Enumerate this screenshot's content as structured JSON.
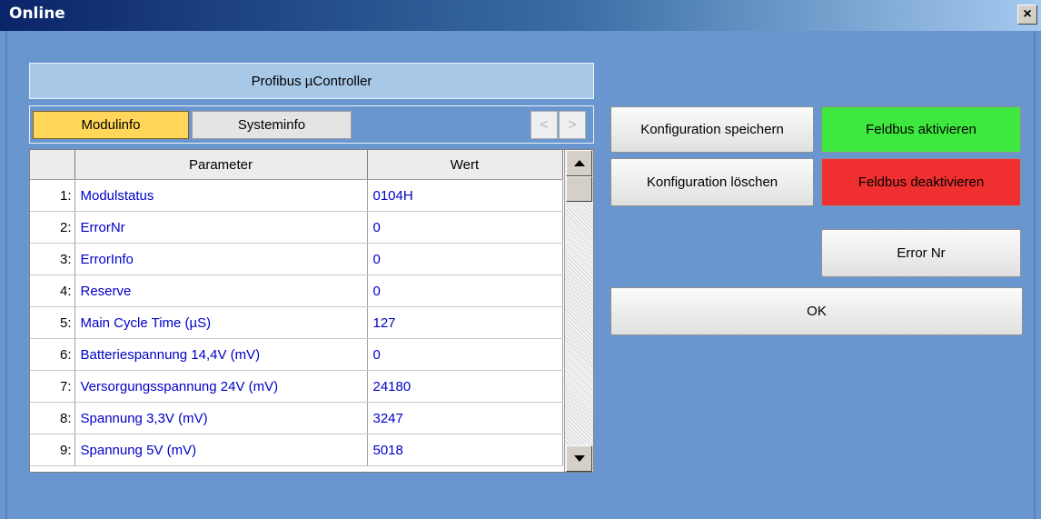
{
  "window": {
    "title": "Online",
    "close_glyph": "×"
  },
  "panel": {
    "header": "Profibus µController"
  },
  "tabs": {
    "modulinfo": "Modulinfo",
    "systeminfo": "Systeminfo",
    "prev": "<",
    "next": ">"
  },
  "table": {
    "columns": {
      "parameter": "Parameter",
      "wert": "Wert"
    },
    "rows": [
      {
        "num": "1:",
        "parameter": "Modulstatus",
        "wert": "0104H"
      },
      {
        "num": "2:",
        "parameter": "ErrorNr",
        "wert": "0"
      },
      {
        "num": "3:",
        "parameter": "ErrorInfo",
        "wert": "0"
      },
      {
        "num": "4:",
        "parameter": "Reserve",
        "wert": "0"
      },
      {
        "num": "5:",
        "parameter": "Main Cycle Time (µS)",
        "wert": "127"
      },
      {
        "num": "6:",
        "parameter": "Batteriespannung 14,4V (mV)",
        "wert": "0"
      },
      {
        "num": "7:",
        "parameter": "Versorgungsspannung 24V (mV)",
        "wert": "24180"
      },
      {
        "num": "8:",
        "parameter": "Spannung 3,3V (mV)",
        "wert": "3247"
      },
      {
        "num": "9:",
        "parameter": "Spannung 5V (mV)",
        "wert": "5018"
      }
    ]
  },
  "buttons": {
    "save_config": "Konfiguration speichern",
    "delete_config": "Konfiguration löschen",
    "feldbus_on": "Feldbus aktivieren",
    "feldbus_off": "Feldbus deaktivieren",
    "error_nr": "Error Nr",
    "ok": "OK"
  },
  "colors": {
    "background": "#6a96cf",
    "active_tab": "#ffd65a",
    "activate": "#3ee83e",
    "deactivate": "#f03030",
    "cell_text": "#0000c8"
  }
}
